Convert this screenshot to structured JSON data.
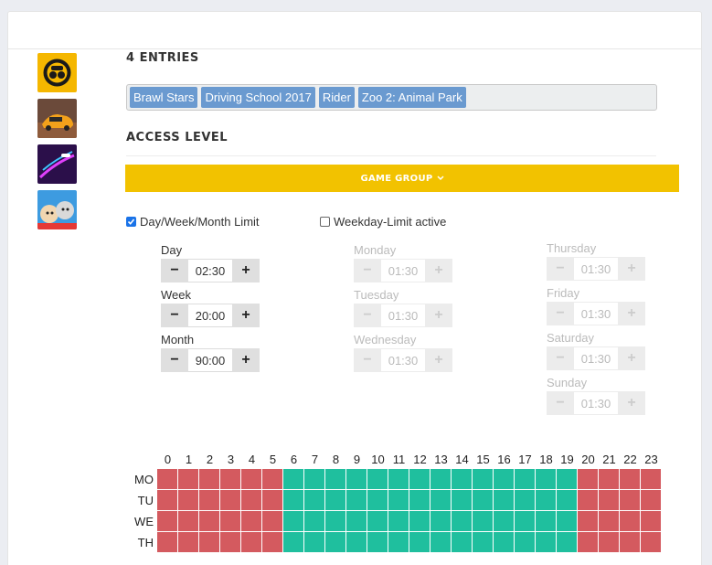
{
  "entries_title": "4 ENTRIES",
  "apps": [
    {
      "name": "Brawl Stars",
      "icon": "brawl-stars-icon"
    },
    {
      "name": "Driving School 2017",
      "icon": "driving-school-icon"
    },
    {
      "name": "Rider",
      "icon": "rider-icon"
    },
    {
      "name": "Zoo 2: Animal Park",
      "icon": "zoo-animal-park-icon"
    }
  ],
  "access_title": "ACCESS LEVEL",
  "group_button": "GAME GROUP",
  "checkboxes": {
    "day_limit": {
      "label": "Day/Week/Month Limit",
      "checked": true
    },
    "weekday_limit": {
      "label": "Weekday-Limit active",
      "checked": false
    }
  },
  "limits": {
    "day": {
      "label": "Day",
      "value": "02:30"
    },
    "week": {
      "label": "Week",
      "value": "20:00"
    },
    "month": {
      "label": "Month",
      "value": "90:00"
    }
  },
  "weekdays": {
    "monday": {
      "label": "Monday",
      "value": "01:30"
    },
    "tuesday": {
      "label": "Tuesday",
      "value": "01:30"
    },
    "wednesday": {
      "label": "Wednesday",
      "value": "01:30"
    },
    "thursday": {
      "label": "Thursday",
      "value": "01:30"
    },
    "friday": {
      "label": "Friday",
      "value": "01:30"
    },
    "saturday": {
      "label": "Saturday",
      "value": "01:30"
    },
    "sunday": {
      "label": "Sunday",
      "value": "01:30"
    }
  },
  "schedule": {
    "hours": [
      "0",
      "1",
      "2",
      "3",
      "4",
      "5",
      "6",
      "7",
      "8",
      "9",
      "10",
      "11",
      "12",
      "13",
      "14",
      "15",
      "16",
      "17",
      "18",
      "19",
      "20",
      "21",
      "22",
      "23"
    ],
    "days": [
      "MO",
      "TU",
      "WE",
      "TH"
    ],
    "allowed_from": 6,
    "allowed_to": 19,
    "colors": {
      "blocked": "#d45a5f",
      "allowed": "#1fbf9e"
    }
  },
  "colors": {
    "accent": "#f2c200",
    "tag": "#6a9ad0"
  }
}
